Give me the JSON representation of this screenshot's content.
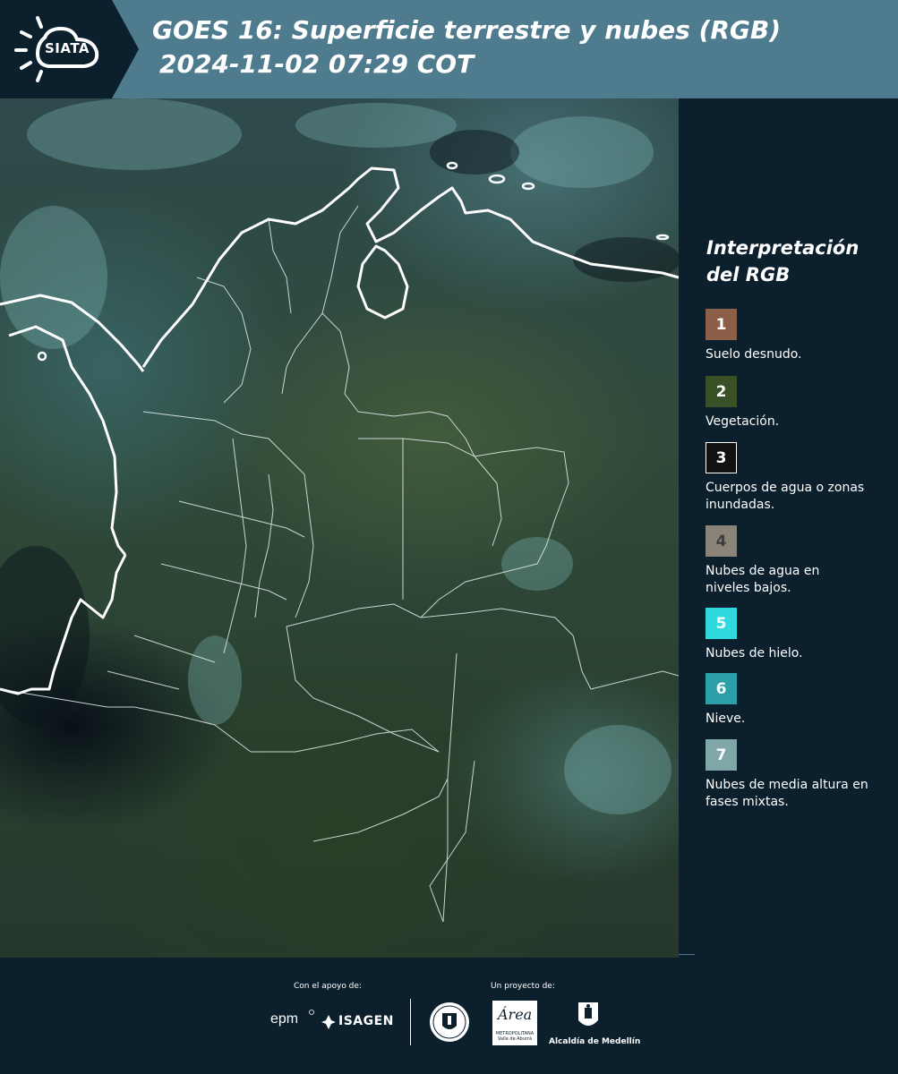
{
  "header": {
    "logo_text": "SIATA",
    "title": "GOES 16: Superficie terrestre y nubes (RGB)",
    "subtitle": "2024-11-02 07:29 COT"
  },
  "legend": {
    "title": "Interpretación del RGB",
    "items": [
      {
        "number": "1",
        "label": "Suelo desnudo.",
        "color": "#8b5e48"
      },
      {
        "number": "2",
        "label": "Vegetación.",
        "color": "#3a5128"
      },
      {
        "number": "3",
        "label": "Cuerpos de agua o zonas inundadas.",
        "color": "#111111"
      },
      {
        "number": "4",
        "label": "Nubes de agua en niveles bajos.",
        "color": "#8a8478"
      },
      {
        "number": "5",
        "label": "Nubes de hielo.",
        "color": "#2fd9dd"
      },
      {
        "number": "6",
        "label": "Nieve.",
        "color": "#2a9fa7"
      },
      {
        "number": "7",
        "label": "Nubes de media altura en fases mixtas.",
        "color": "#7fa7a8"
      }
    ]
  },
  "footer": {
    "support_label": "Con el apoyo de:",
    "project_label": "Un proyecto de:",
    "epm": "epm",
    "isagen": "ISAGEN",
    "amva_script": "Área",
    "amva_text": "METROPOLITANA Valle de Aburrá",
    "alcaldia": "Alcaldía de Medellín"
  },
  "colors": {
    "header_bg": "#4e7b8d",
    "panel_bg": "#0b1f2d"
  }
}
